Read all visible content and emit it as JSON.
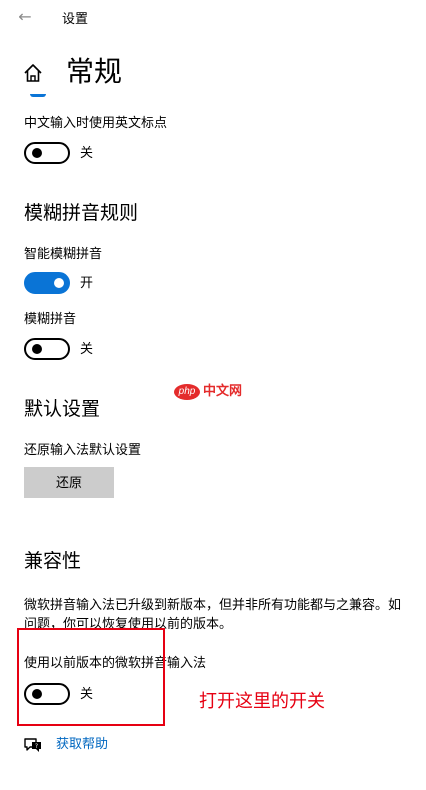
{
  "titlebar": {
    "back_icon": "back-arrow-icon",
    "title": "设置"
  },
  "page": {
    "home_icon": "home-icon",
    "title": "常规"
  },
  "english_punct": {
    "label": "中文输入时使用英文标点",
    "state": "关",
    "on": false
  },
  "fuzzy_section": {
    "title": "模糊拼音规则",
    "smart_fuzzy": {
      "label": "智能模糊拼音",
      "state": "开",
      "on": true
    },
    "fuzzy": {
      "label": "模糊拼音",
      "state": "关",
      "on": false
    }
  },
  "default_section": {
    "title": "默认设置",
    "reset_label": "还原输入法默认设置",
    "reset_button": "还原"
  },
  "compat_section": {
    "title": "兼容性",
    "desc_line1": "微软拼音输入法已升级到新版本，但并非所有功能都与之兼容。如",
    "desc_line2": "问题，你可以恢复使用以前的版本。",
    "prev_version": {
      "label": "使用以前版本的微软拼音输入法",
      "state": "关",
      "on": false
    }
  },
  "annotation": {
    "text": "打开这里的开关",
    "color": "#e60012"
  },
  "watermark": {
    "php": "php",
    "site": "中文网"
  },
  "help": {
    "icon": "help-chat-icon",
    "link": "获取帮助"
  },
  "colors": {
    "accent": "#0a74d6",
    "button": "#cccccc",
    "link": "#0067c0"
  }
}
